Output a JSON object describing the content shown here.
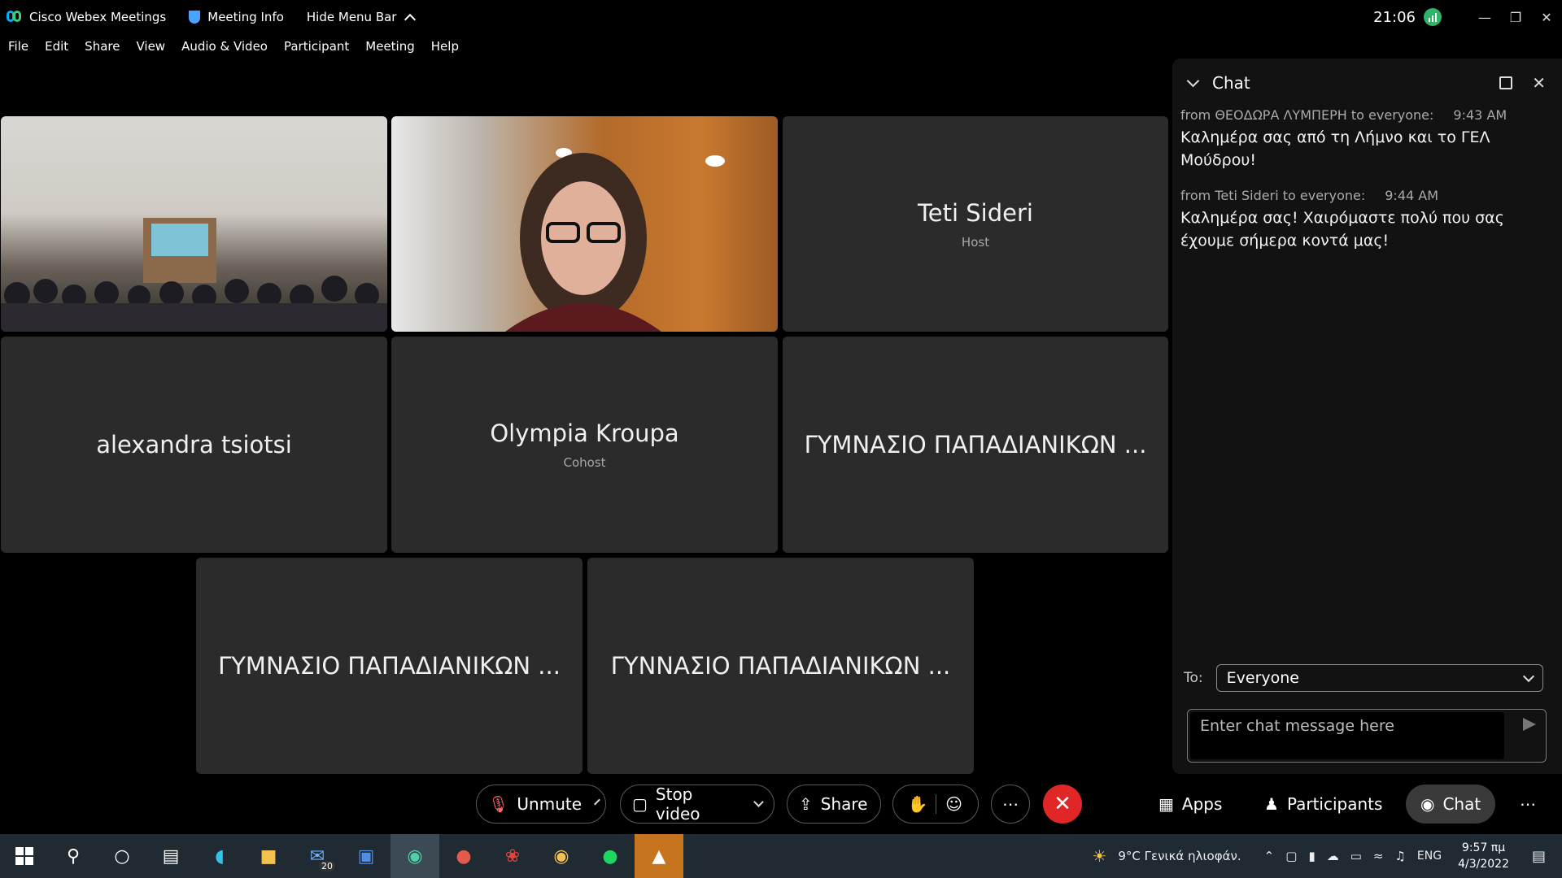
{
  "titlebar": {
    "app_name": "Cisco Webex Meetings",
    "meeting_info": "Meeting Info",
    "hide_menu": "Hide Menu Bar",
    "clock": "21:06"
  },
  "menu": [
    "File",
    "Edit",
    "Share",
    "View",
    "Audio & Video",
    "Participant",
    "Meeting",
    "Help"
  ],
  "participants": [
    {
      "name": "Teti Sideri",
      "role": "Host"
    },
    {
      "name": "alexandra tsiotsi",
      "role": ""
    },
    {
      "name": "Olympia Kroupa",
      "role": "Cohost"
    },
    {
      "name": "ΓΥΜΝΑΣΙΟ ΠΑΠΑΔΙΑΝΙΚΩΝ ...",
      "role": ""
    },
    {
      "name": "ΓΥΜΝΑΣΙΟ ΠΑΠΑΔΙΑΝΙΚΩΝ ...",
      "role": ""
    },
    {
      "name": "ΓΥΝΝΑΣΙΟ ΠΑΠΑΔΙΑΝΙΚΩΝ ...",
      "role": ""
    }
  ],
  "chat": {
    "title": "Chat",
    "messages": [
      {
        "from": "from ΘΕΟΔΩΡΑ ΛΥΜΠΕΡΗ to everyone:",
        "time": "9:43 AM",
        "text": "Καλημέρα σας από τη Λήμνο και το ΓΕΛ Μούδρου!"
      },
      {
        "from": "from Teti Sideri to everyone:",
        "time": "9:44 AM",
        "text": "Καλημέρα σας! Χαιρόμαστε πολύ που σας έχουμε σήμερα κοντά μας!"
      }
    ],
    "to_label": "To:",
    "recipient": "Everyone",
    "placeholder": "Enter chat message here"
  },
  "controls": {
    "unmute": "Unmute",
    "stop_video": "Stop video",
    "share": "Share",
    "apps": "Apps",
    "participants": "Participants",
    "chat": "Chat"
  },
  "taskbar": {
    "mail_badge": "20",
    "weather": "9°C  Γενικά ηλιοφάν.",
    "lang": "ENG",
    "time": "9:57 πμ",
    "date": "4/3/2022"
  },
  "colors": {
    "end_call": "#e02626",
    "signal": "#2fb56a",
    "taskbar": "#1f2a33"
  }
}
